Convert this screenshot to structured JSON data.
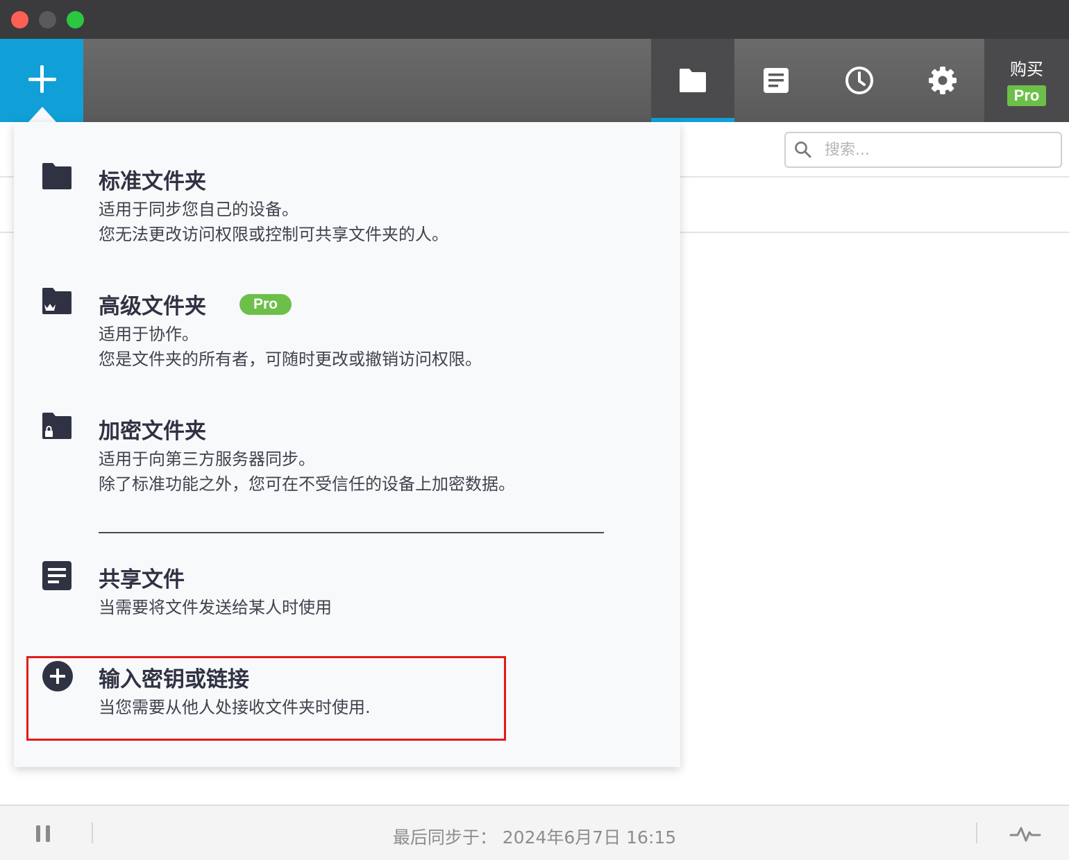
{
  "toolbar": {
    "add_icon": "plus-icon",
    "tabs": [
      {
        "name": "folders",
        "icon": "folder-icon",
        "active": true
      },
      {
        "name": "shared-files",
        "icon": "document-icon",
        "active": false
      },
      {
        "name": "history",
        "icon": "clock-icon",
        "active": false
      },
      {
        "name": "settings",
        "icon": "gear-icon",
        "active": false
      }
    ],
    "buy_label": "购买",
    "pro_badge": "Pro",
    "accent_color": "#10a0d7"
  },
  "search": {
    "placeholder": "搜索..."
  },
  "menu": {
    "items": [
      {
        "icon": "folder-icon",
        "title": "标准文件夹",
        "desc": [
          "适用于同步您自己的设备。",
          "您无法更改访问权限或控制可共享文件夹的人。"
        ]
      },
      {
        "icon": "crown-folder-icon",
        "title": "高级文件夹",
        "badge": "Pro",
        "desc": [
          "适用于协作。",
          "您是文件夹的所有者，可随时更改或撤销访问权限。"
        ]
      },
      {
        "icon": "lock-folder-icon",
        "title": "加密文件夹",
        "desc": [
          "适用于向第三方服务器同步。",
          "除了标准功能之外，您可在不受信任的设备上加密数据。"
        ]
      },
      {
        "icon": "document-icon",
        "title": "共享文件",
        "desc": [
          "当需要将文件发送给某人时使用"
        ]
      },
      {
        "icon": "plus-circle-icon",
        "title": "输入密钥或链接",
        "desc": [
          "当您需要从他人处接收文件夹时使用."
        ],
        "highlighted": true
      }
    ],
    "highlight_color": "#e31919",
    "pro_color": "#6cc04a"
  },
  "status": {
    "pause_icon": "pause-icon",
    "last_sync": "最后同步于：  2024年6月7日 16:15",
    "activity_icon": "pulse-icon"
  }
}
